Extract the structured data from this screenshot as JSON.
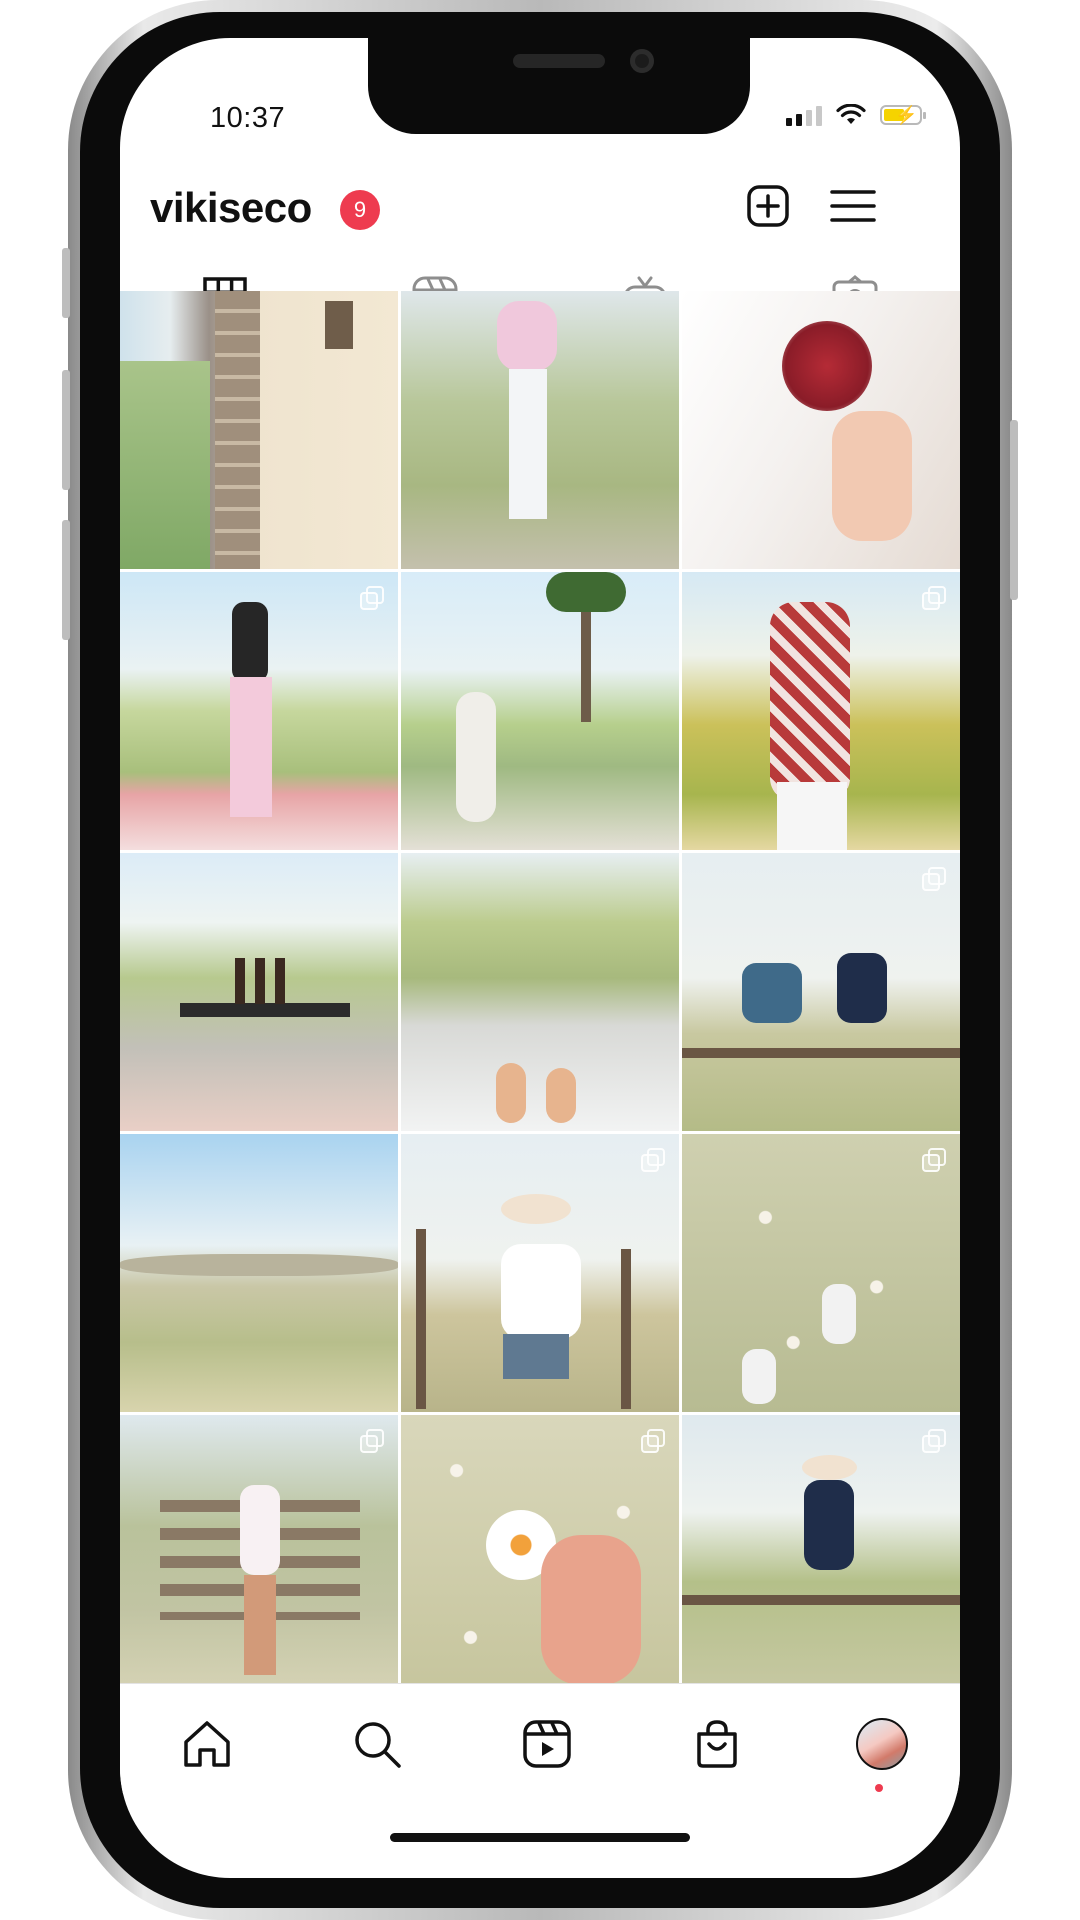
{
  "status_bar": {
    "time": "10:37",
    "signal_bars_active": 2,
    "battery_level": 0.6,
    "battery_charging": true,
    "battery_color": "#f5d300"
  },
  "header": {
    "username": "vikiseco",
    "notification_count": "9",
    "badge_color": "#ee3b4f",
    "new_post_icon": "plus-square-icon",
    "menu_icon": "hamburger-menu-icon"
  },
  "tabs": [
    {
      "name": "posts",
      "icon": "grid-icon",
      "active": true
    },
    {
      "name": "reels",
      "icon": "reels-icon",
      "active": false
    },
    {
      "name": "igtv",
      "icon": "igtv-icon",
      "active": false
    },
    {
      "name": "tagged",
      "icon": "tagged-person-icon",
      "active": false
    }
  ],
  "posts": [
    {
      "description": "winery building with stone column and lake view",
      "multi": false
    },
    {
      "description": "woman in pink sweater among vineyard plants",
      "multi": false
    },
    {
      "description": "hand holding red wine glass with logo",
      "multi": false
    },
    {
      "description": "woman in pink pants on balcony over vineyard",
      "multi": true
    },
    {
      "description": "garden path with statue and palm tree",
      "multi": false
    },
    {
      "description": "woman in red patterned shirt in autumn vineyard",
      "multi": true
    },
    {
      "description": "wine tasting table with bottles and glasses",
      "multi": false
    },
    {
      "description": "legs over rocky river rapids",
      "multi": false
    },
    {
      "description": "couple sitting on wooden fence in field",
      "multi": true
    },
    {
      "description": "hills and grassland landscape under blue sky",
      "multi": false
    },
    {
      "description": "woman in cowboy hat by wooden fence",
      "multi": true
    },
    {
      "description": "feet in white sneakers among daisies",
      "multi": true
    },
    {
      "description": "woman leaning on wooden farm gate",
      "multi": true
    },
    {
      "description": "hand holding white daisy over flowers",
      "multi": true
    },
    {
      "description": "woman in hat on fence pointing at hills",
      "multi": true
    }
  ],
  "bottom_nav": [
    {
      "name": "home",
      "icon": "home-icon"
    },
    {
      "name": "search",
      "icon": "search-icon"
    },
    {
      "name": "reels",
      "icon": "reels-icon"
    },
    {
      "name": "shop",
      "icon": "shopping-bag-icon"
    },
    {
      "name": "profile",
      "icon": "profile-avatar"
    }
  ]
}
